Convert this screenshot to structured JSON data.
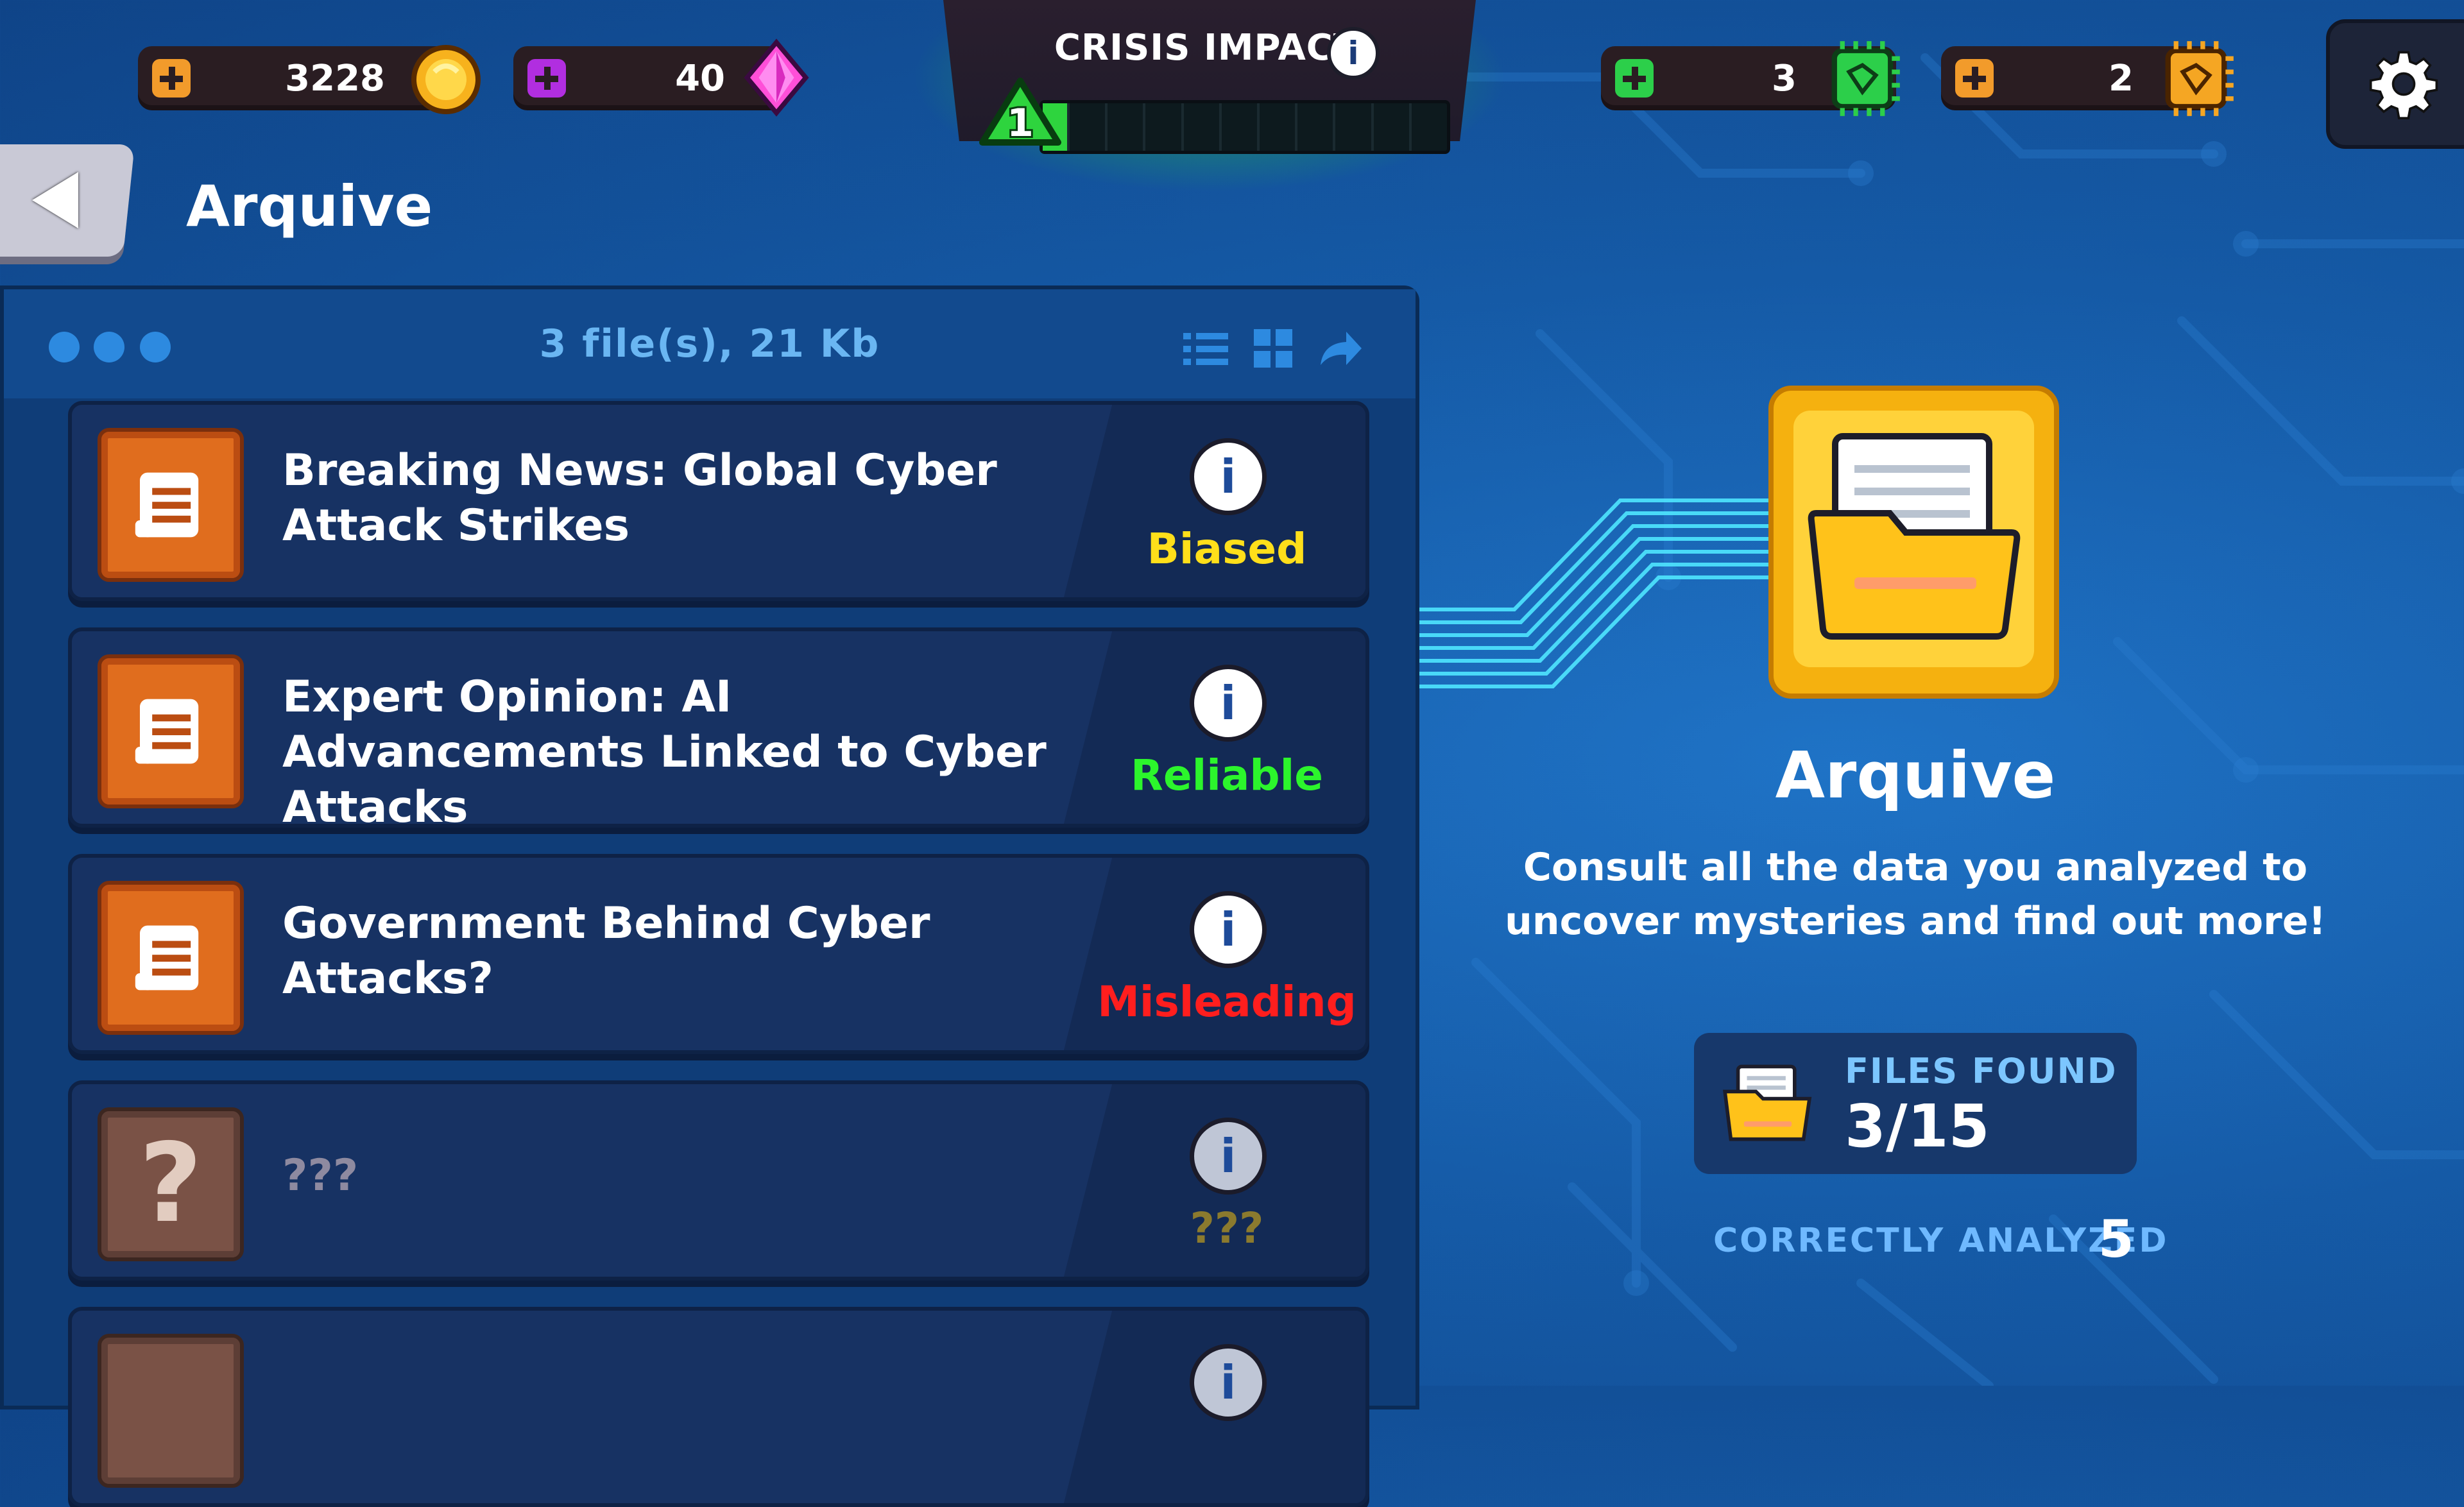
{
  "currencies": {
    "coins": {
      "value": "3228",
      "icon": "gold-coin-icon",
      "accent": "#f5a623"
    },
    "gems": {
      "value": "40",
      "icon": "pink-gem-icon",
      "accent": "#b12ee0"
    },
    "green_chips": {
      "value": "3",
      "icon": "green-chip-icon",
      "accent": "#2ccf4a"
    },
    "orange_chips": {
      "value": "2",
      "icon": "orange-chip-icon",
      "accent": "#f5a623"
    }
  },
  "crisis": {
    "title": "CRISIS IMPACT",
    "level": "1",
    "segments": 10,
    "progress_fraction": 0.05
  },
  "header": {
    "title": "Arquive"
  },
  "panel": {
    "summary": "3 file(s), 21 Kb",
    "files": [
      {
        "title": "Breaking News: Global Cyber Attack Strikes",
        "rating": "Biased",
        "rating_color": "#ffdf1a",
        "locked": false
      },
      {
        "title": "Expert Opinion: AI Advancements Linked to Cyber Attacks",
        "rating": "Reliable",
        "rating_color": "#2cf52c",
        "locked": false
      },
      {
        "title": "Government Behind Cyber Attacks?",
        "rating": "Misleading",
        "rating_color": "#ff1e1e",
        "locked": false
      },
      {
        "title": "???",
        "rating": "???",
        "rating_color": "#8b7a2e",
        "locked": true
      }
    ]
  },
  "right": {
    "title": "Arquive",
    "description": "Consult all the data you analyzed to uncover mysteries and find out more!",
    "files_found_label": "FILES FOUND",
    "files_found_value": "3/15",
    "correctly_analyzed_label": "CORRECTLY ANALYZED",
    "correctly_analyzed_value": "5"
  }
}
